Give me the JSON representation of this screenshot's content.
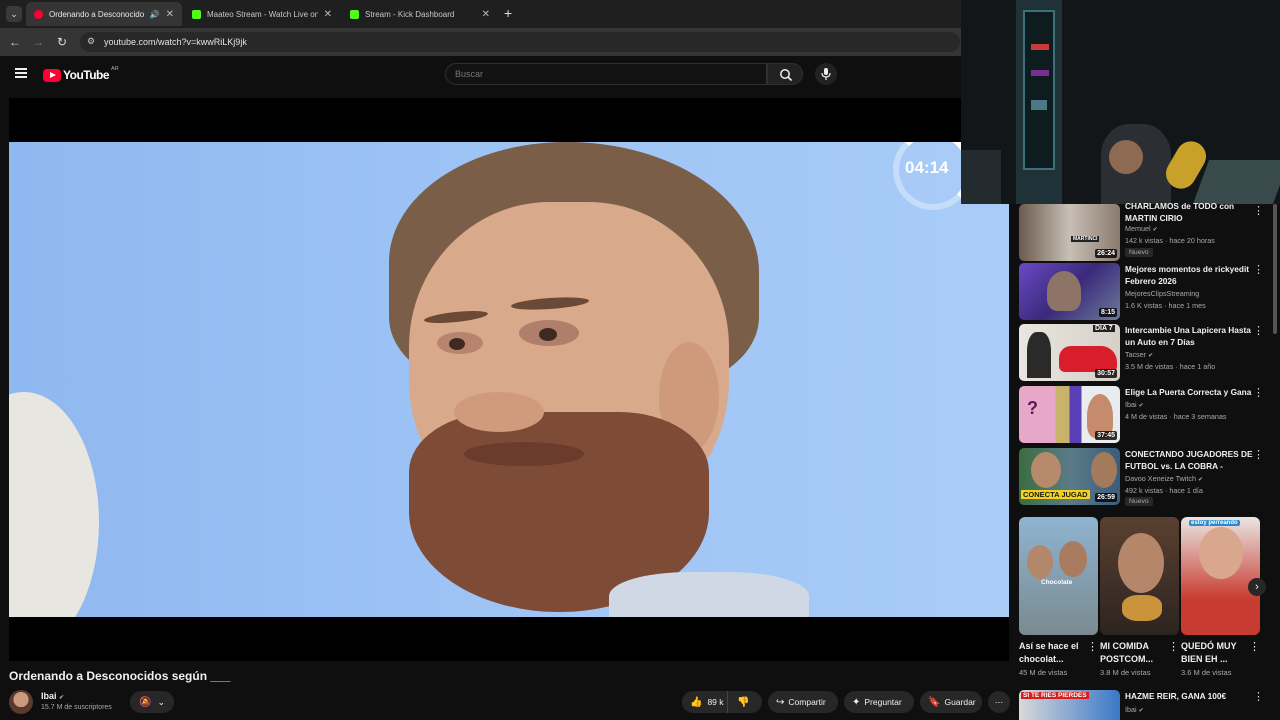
{
  "browser": {
    "tabs": [
      {
        "title": "Ordenando a Desconocido"
      },
      {
        "title": "Maateo Stream - Watch Live on"
      },
      {
        "title": "Stream - Kick Dashboard"
      }
    ],
    "url": "youtube.com/watch?v=kwwRiLKj9jk"
  },
  "header": {
    "logo": "YouTube",
    "region": "AR",
    "search_placeholder": "Buscar"
  },
  "player": {
    "timer": "04:14"
  },
  "video": {
    "title": "Ordenando a Desconocidos según ___",
    "channel": "Ibai",
    "subscribers": "15.7 M de suscriptores",
    "likes": "89 k",
    "share_label": "Compartir",
    "ask_label": "Preguntar",
    "save_label": "Guardar"
  },
  "related": [
    {
      "title": "CHARLAMOS de TODO con MARTIN CIRIO",
      "channel": "Memuel",
      "meta": "142 k vistas · hace 20 horas",
      "duration": "26:24",
      "badge": "Nuevo",
      "verified": true
    },
    {
      "title": "Mejores momentos de rickyedit Febrero 2026",
      "channel": "MejoresClipsStreaming",
      "meta": "1.6 K vistas · hace 1 mes",
      "duration": "8:15",
      "badge": "",
      "verified": false
    },
    {
      "title": "Intercambie Una Lapicera Hasta un Auto en 7 Días",
      "channel": "Tacser",
      "meta": "3.5 M de vistas · hace 1 año",
      "duration": "30:57",
      "badge": "",
      "verified": true
    },
    {
      "title": "Elige La Puerta Correcta y Gana",
      "channel": "Ibai",
      "meta": "4 M de vistas · hace 3 semanas",
      "duration": "37:45",
      "badge": "",
      "verified": true
    },
    {
      "title": "CONECTANDO JUGADORES DE FUTBOL vs. LA COBRA - ¿QUIE...",
      "channel": "Davoo Xeneize Twitch",
      "meta": "492 k vistas · hace 1 día",
      "duration": "26:59",
      "badge": "Nuevo",
      "verified": true
    },
    {
      "title": "HAZME REIR, GANA 100€",
      "channel": "Ibai",
      "meta": "",
      "duration": "",
      "badge": "",
      "verified": true
    }
  ],
  "thumb_text": {
    "martin": "MARTINCI",
    "dia": "DIA 7",
    "conecta": "CONECTA JUGAD",
    "chocolate": "Chocolate",
    "estoy": "estoy perreando",
    "siteries": "SI TE RIES PIERDES"
  },
  "shorts": [
    {
      "title": "Así se hace el chocolat...",
      "views": "45 M de vistas"
    },
    {
      "title": "MI COMIDA POSTCOM...",
      "views": "3.8 M de vistas"
    },
    {
      "title": "QUEDÓ MUY BIEN EH ...",
      "views": "3.6 M de vistas"
    }
  ]
}
